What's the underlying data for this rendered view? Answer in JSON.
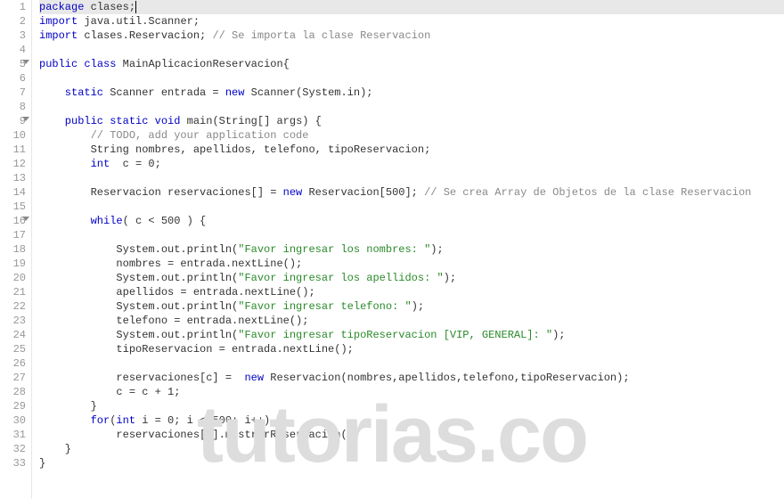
{
  "gutter": {
    "lines": [
      "1",
      "2",
      "3",
      "4",
      "5",
      "6",
      "7",
      "8",
      "9",
      "10",
      "11",
      "12",
      "13",
      "14",
      "15",
      "16",
      "17",
      "18",
      "19",
      "20",
      "21",
      "22",
      "23",
      "24",
      "25",
      "26",
      "27",
      "28",
      "29",
      "30",
      "31",
      "32",
      "33"
    ],
    "fold_lines": [
      5,
      9,
      16
    ]
  },
  "code": {
    "l1_kw": "package",
    "l1_rest": " clases;",
    "l2_kw": "import",
    "l2_rest": " java.util.Scanner;",
    "l3_kw": "import",
    "l3_rest": " clases.Reservacion; ",
    "l3_com": "// Se importa la clase Reservacion",
    "l5_kw1": "public",
    "l5_kw2": " class",
    "l5_name": " MainAplicacionReservacion{",
    "l7_kw1": "    static",
    "l7_type": " Scanner",
    "l7_mid": " entrada = ",
    "l7_kw2": "new",
    "l7_rest": " Scanner(System.in);",
    "l9_kw1": "    public",
    "l9_kw2": " static",
    "l9_kw3": " void",
    "l9_name": " main(String[] args) {",
    "l10_com": "        // TODO, add your application code",
    "l11_type": "        String",
    "l11_rest": " nombres, apellidos, telefono, tipoReservacion;",
    "l12_type": "        int",
    "l12_rest": "  c = 0;",
    "l14_a": "        Reservacion reservaciones[] = ",
    "l14_kw": "new",
    "l14_b": " Reservacion[500]; ",
    "l14_com": "// Se crea Array de Objetos de la clase Reservacion",
    "l16_kw": "        while",
    "l16_rest": "( c < 500 ) {",
    "l18_a": "            System.out.println(",
    "l18_str": "\"Favor ingresar los nombres: \"",
    "l18_b": ");",
    "l19": "            nombres = entrada.nextLine();",
    "l20_a": "            System.out.println(",
    "l20_str": "\"Favor ingresar los apellidos: \"",
    "l20_b": ");",
    "l21": "            apellidos = entrada.nextLine();",
    "l22_a": "            System.out.println(",
    "l22_str": "\"Favor ingresar telefono: \"",
    "l22_b": ");",
    "l23": "            telefono = entrada.nextLine();",
    "l24_a": "            System.out.println(",
    "l24_str": "\"Favor ingresar tipoReservacion [VIP, GENERAL]: \"",
    "l24_b": ");",
    "l25": "            tipoReservacion = entrada.nextLine();",
    "l27_a": "            reservaciones[c] =  ",
    "l27_kw": "new",
    "l27_b": " Reservacion(nombres,apellidos,telefono,tipoReservacion);",
    "l28": "            c = c + 1;",
    "l29": "        }",
    "l30_kw": "        for",
    "l30_a": "(",
    "l30_type": "int",
    "l30_b": " i = 0; i < 500; i++)",
    "l31": "            reservaciones[i].mostrarReservacion();",
    "l32": "    }",
    "l33": "}"
  },
  "watermark": "tutorias.co"
}
